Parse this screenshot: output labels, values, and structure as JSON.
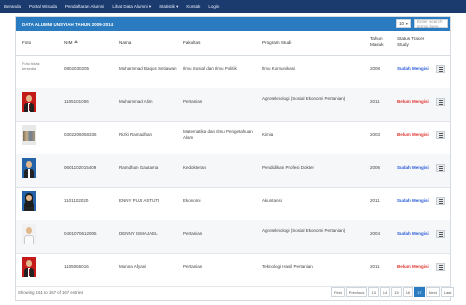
{
  "nav": [
    "Beranda",
    "Portal Wisuda",
    "Pendaftaran Alumni",
    "Lihat Data Alumni ▾",
    "Statistik ▾",
    "Kontak",
    "Login"
  ],
  "panel": {
    "title": "DATA ALUMNI UNSYIAH TAHUN 2009-2014",
    "page_size": "10",
    "search_placeholder": "Enter search terms here"
  },
  "table": {
    "headers": [
      "Foto",
      "NIM",
      "Nama",
      "Fakultas",
      "Program Studi",
      "Tahun Masuk",
      "Status Tracer Study"
    ],
    "rows": [
      {
        "photo": "none",
        "photo_text": "Foto tidak tersedia",
        "nim": "0802030205",
        "nama": "Muhammad Baqus Setiawan",
        "fakultas": "Ilmu Sosial dan Ilmu Politik",
        "prodi": "Ilmu Komunikasi",
        "tahun": "2008",
        "status": "Sudah Mengisi"
      },
      {
        "photo": "red-male",
        "nim": "1105101006",
        "nama": "Muhammad Alim",
        "fakultas": "Pertanian",
        "prodi": "Agroteknologi (Sosial Ekonomi Pertanian)",
        "tahun": "2011",
        "status": "Belum Mengisi"
      },
      {
        "photo": "group",
        "nim": "0302206058336",
        "nama": "Rizki Ramadhan",
        "fakultas": "Matematika dan Ilmu Pengetahuan Alam",
        "prodi": "Kimia",
        "tahun": "2003",
        "status": "Belum Mengisi"
      },
      {
        "photo": "blue-male",
        "nim": "0601102015409",
        "nama": "Ramdhan Gautama",
        "fakultas": "Kedokteran",
        "prodi": "Pendidikan Profesi Dokter",
        "tahun": "2006",
        "status": "Sudah Mengisi"
      },
      {
        "photo": "blue-female",
        "nim": "1101102020",
        "nama": "ENNY PUJI ASTUTI",
        "fakultas": "Ekonomi",
        "prodi": "Akuntansi",
        "tahun": "2011",
        "status": "Sudah Mengisi"
      },
      {
        "photo": "white-male",
        "nim": "0401070612005",
        "nama": "DENNY ISMAJAEL",
        "fakultas": "Pertanian",
        "prodi": "Agroteknologi (Sosial Ekonomi Pertanian)",
        "tahun": "2004",
        "status": "Sudah Mengisi"
      },
      {
        "photo": "red-male",
        "nim": "1105055016",
        "nama": "Munna Afyani",
        "fakultas": "Pertanian",
        "prodi": "Teknologi Hasil Pertanian",
        "tahun": "2011",
        "status": "Belum Mengisi"
      }
    ]
  },
  "footer": {
    "info": "Showing 161 to 167 of 167 entries",
    "pages": [
      "First",
      "Previous",
      "13",
      "14",
      "15",
      "16",
      "17",
      "Next",
      "Last"
    ],
    "active_page": "17"
  },
  "colors": {
    "nav_bg": "#1b3b6f",
    "panel_head": "#2a7bc0",
    "status_done": "#2a5bd7",
    "status_pending": "#e0332f"
  }
}
